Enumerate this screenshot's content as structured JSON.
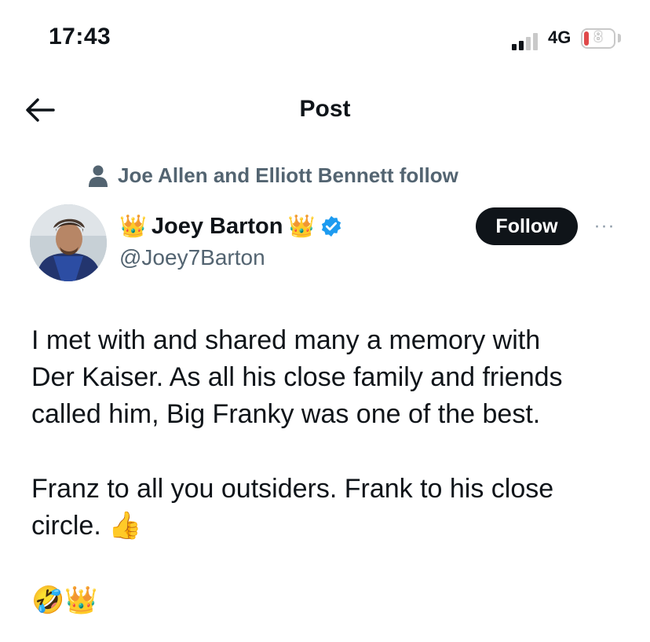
{
  "status_bar": {
    "time": "17:43",
    "network": "4G",
    "battery_level": "8",
    "battery_color": "#e0494a"
  },
  "header": {
    "back_icon": "arrow-left-icon",
    "title": "Post"
  },
  "social_context": {
    "icon": "person-icon",
    "text": "Joe Allen and Elliott Bennett follow"
  },
  "author": {
    "name": "Joey Barton",
    "handle": "@Joey7Barton",
    "prefix_emoji": "👑",
    "suffix_emoji": "👑",
    "verified_icon": "verified-badge-icon",
    "verified_color": "#1d9bf0",
    "follow_label": "Follow",
    "more_label": "···"
  },
  "tweet": {
    "line1": "I met with and shared many a memory with",
    "line2": "Der Kaiser. As all his close family and friends",
    "line3": "called him, Big Franky was one of the best.",
    "line4": "Franz to all you outsiders. Frank to his close",
    "line5": "circle.",
    "thumbs_emoji": "👍",
    "final_emojis": "🤣👑"
  }
}
